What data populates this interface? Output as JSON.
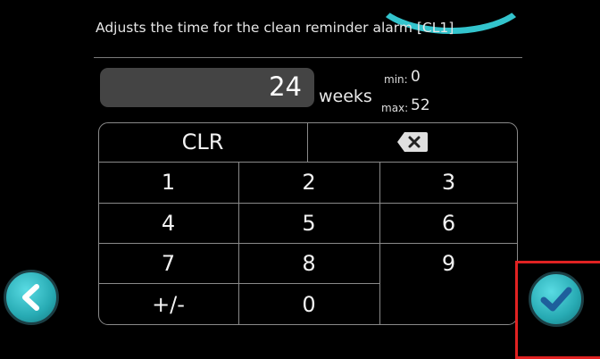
{
  "description": "Adjusts the time for the clean reminder alarm [CL1]",
  "value": "24",
  "unit": "weeks",
  "limits": {
    "min_label": "min:",
    "min_value": "0",
    "max_label": "max:",
    "max_value": "52"
  },
  "keypad": {
    "clear": "CLR",
    "keys": [
      "1",
      "2",
      "3",
      "4",
      "5",
      "6",
      "7",
      "8",
      "9"
    ],
    "sign": "+/-",
    "zero": "0"
  },
  "icons": {
    "back": "chevron-left-icon",
    "confirm": "checkmark-icon",
    "backspace": "backspace-icon"
  },
  "colors": {
    "accent": "#33c4cd",
    "field": "#444444",
    "highlight": "#e02222"
  }
}
